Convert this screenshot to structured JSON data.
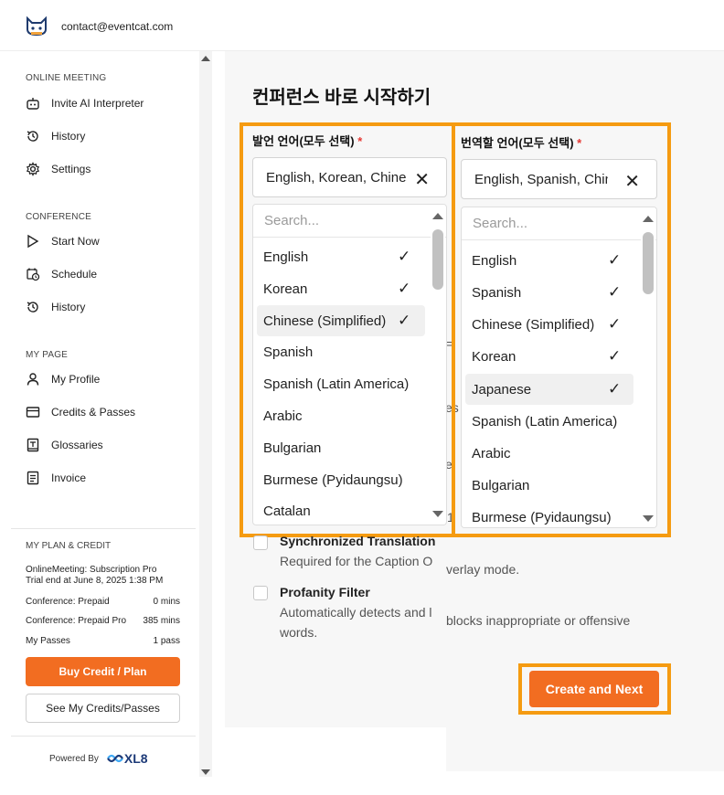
{
  "header": {
    "email": "contact@eventcat.com",
    "logo_icon": "cat-logo-icon"
  },
  "sidebar": {
    "online_meeting": {
      "title": "ONLINE MEETING",
      "items": [
        {
          "label": "Invite AI Interpreter",
          "icon": "robot-icon"
        },
        {
          "label": "History",
          "icon": "history-icon"
        },
        {
          "label": "Settings",
          "icon": "gear-icon"
        }
      ]
    },
    "conference": {
      "title": "CONFERENCE",
      "items": [
        {
          "label": "Start Now",
          "icon": "play-icon"
        },
        {
          "label": "Schedule",
          "icon": "calendar-clock-icon"
        },
        {
          "label": "History",
          "icon": "history-icon"
        }
      ]
    },
    "my_page": {
      "title": "MY PAGE",
      "items": [
        {
          "label": "My Profile",
          "icon": "user-icon"
        },
        {
          "label": "Credits & Passes",
          "icon": "card-icon"
        },
        {
          "label": "Glossaries",
          "icon": "book-icon"
        },
        {
          "label": "Invoice",
          "icon": "document-icon"
        }
      ]
    },
    "plan": {
      "title": "MY PLAN & CREDIT",
      "subscription": "OnlineMeeting: Subscription Pro",
      "trial": "Trial end at June 8, 2025 1:38 PM",
      "rows": [
        {
          "label": "Conference: Prepaid",
          "value": "0 mins"
        },
        {
          "label": "Conference: Prepaid Pro",
          "value": "385 mins"
        },
        {
          "label": "My Passes",
          "value": "1 pass"
        }
      ],
      "buy_label": "Buy Credit / Plan",
      "see_label": "See My Credits/Passes"
    },
    "powered_by": "Powered By",
    "brand": "XL8"
  },
  "main": {
    "title": "컨퍼런스 바로 시작하기",
    "source": {
      "label": "발언 언어(모두 선택)",
      "required_mark": "*",
      "value": "English, Korean, Chinese (Simplified)",
      "placeholder": "Search...",
      "options": [
        {
          "label": "English",
          "checked": "✓"
        },
        {
          "label": "Korean",
          "checked": "✓"
        },
        {
          "label": "Chinese (Simplified)",
          "checked": "✓"
        },
        {
          "label": "Spanish",
          "checked": ""
        },
        {
          "label": "Spanish (Latin America)",
          "checked": ""
        },
        {
          "label": "Arabic",
          "checked": ""
        },
        {
          "label": "Bulgarian",
          "checked": ""
        },
        {
          "label": "Burmese (Pyidaungsu)",
          "checked": ""
        },
        {
          "label": "Catalan",
          "checked": ""
        }
      ]
    },
    "target": {
      "label": "번역할 언어(모두 선택)",
      "required_mark": "*",
      "value": "English, Spanish, Chinese (Simplified), Korean, Japanese",
      "placeholder": "Search...",
      "options": [
        {
          "label": "English",
          "checked": "✓"
        },
        {
          "label": "Spanish",
          "checked": "✓"
        },
        {
          "label": "Chinese (Simplified)",
          "checked": "✓"
        },
        {
          "label": "Korean",
          "checked": "✓"
        },
        {
          "label": "Japanese",
          "checked": "✓"
        },
        {
          "label": "Spanish (Latin America)",
          "checked": ""
        },
        {
          "label": "Arabic",
          "checked": ""
        },
        {
          "label": "Bulgarian",
          "checked": ""
        },
        {
          "label": "Burmese (Pyidaungsu)",
          "checked": ""
        }
      ]
    },
    "background_fragments": [
      "=",
      "es",
      "e",
      "1"
    ],
    "options": [
      {
        "title": "Synchronized Translation",
        "desc_a": "Required for the Caption O",
        "desc_b": "verlay mode."
      },
      {
        "title": "Profanity Filter",
        "desc_a": "Automatically detects and l",
        "desc_b": "blocks inappropriate or offensive",
        "desc_c": "words."
      }
    ],
    "next_label": "Create and Next"
  },
  "colors": {
    "accent": "#f26d21",
    "highlight_frame": "#f59b11",
    "required": "#e53935"
  }
}
